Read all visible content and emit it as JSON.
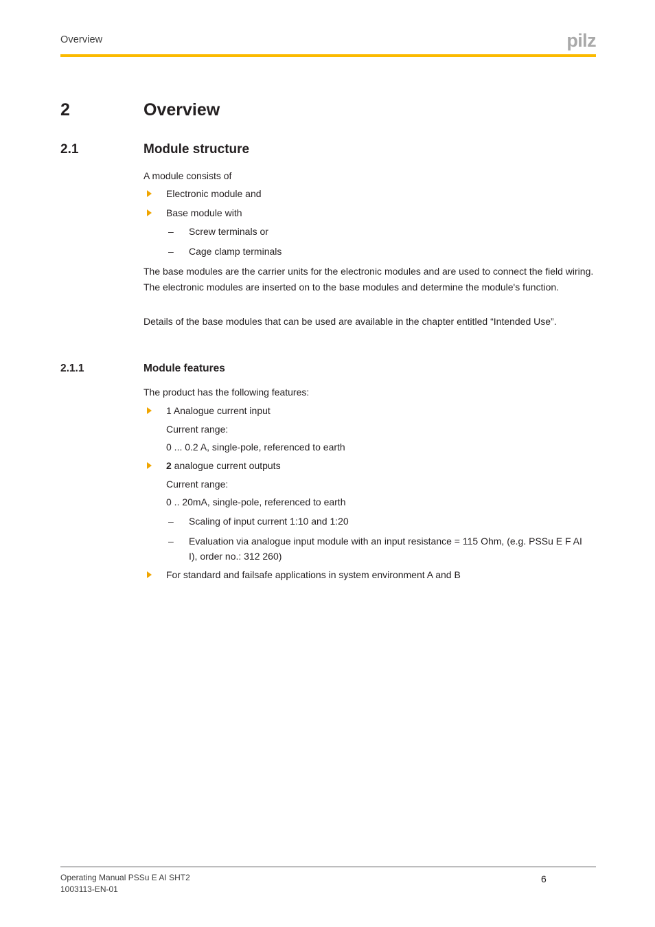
{
  "header": {
    "running_title": "Overview",
    "logo_text": "pilz",
    "rule_color": "#fbba00"
  },
  "colors": {
    "accent": "#fbba00",
    "bullet": "#f0a500",
    "text": "#231f20",
    "logo_gray": "#a9a9a9",
    "footer_rule": "#58585a"
  },
  "chapter": {
    "number": "2",
    "title": "Overview"
  },
  "section": {
    "number": "2.1",
    "title": "Module structure",
    "intro": "A module consists of",
    "bullets": [
      {
        "text": "Electronic module and"
      },
      {
        "text": "Base module with"
      }
    ],
    "sub_bullets": [
      {
        "dash": "–",
        "text": "Screw terminals or"
      },
      {
        "dash": "–",
        "text": "Cage clamp terminals"
      }
    ],
    "paragraph_1": "The base modules are the carrier units for the electronic modules and are used to connect the field wiring. The electronic modules are inserted on to the base modules and determine the module's function.",
    "paragraph_2": "Details of the base modules that can be used are available in the chapter entitled “Intended Use”."
  },
  "subsection": {
    "number": "2.1.1",
    "title": "Module features",
    "intro": "The product has the following features:",
    "feature_1": {
      "heading": "1 Analogue current input",
      "range_label": "Current range:",
      "range_value": "0 ... 0.2 A, single-pole, referenced to earth"
    },
    "feature_2": {
      "heading_bold": "2",
      "heading_rest": " analogue current outputs",
      "range_label": "Current range:",
      "range_value": "0 .. 20mA, single-pole, referenced to earth",
      "sub_bullets": [
        {
          "dash": "–",
          "text": "Scaling of input current 1:10 and 1:20"
        },
        {
          "dash": "–",
          "text": "Evaluation via analogue input module with an input resistance = 115 Ohm, (e.g. PSSu E F AI I), order no.: 312 260)"
        }
      ]
    },
    "feature_3": {
      "text": "For standard and failsafe applications in system environment A and B"
    }
  },
  "footer": {
    "manual_title": "Operating Manual PSSu E AI SHT2",
    "doc_number": "1003113-EN-01",
    "page_number": "6"
  }
}
